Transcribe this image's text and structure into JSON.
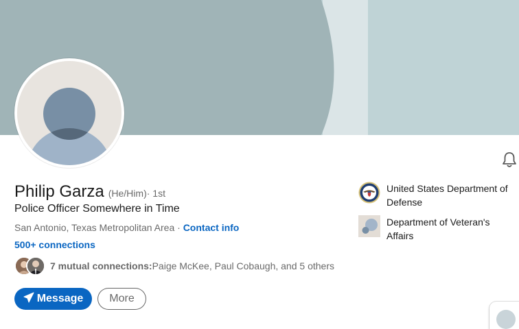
{
  "profile": {
    "name": "Philip Garza",
    "pronouns": "(He/Him)",
    "degree": " · 1st",
    "headline": "Police Officer Somewhere in Time",
    "location": "San Antonio, Texas Metropolitan Area",
    "location_sep": " · ",
    "contact_info_label": "Contact info",
    "connections_label": "500+ connections",
    "mutual": {
      "count_label": "7 mutual connections:",
      "names_label": " Paige McKee, Paul Cobaugh, and 5 others"
    }
  },
  "actions": {
    "message_label": "Message",
    "more_label": "More"
  },
  "organizations": [
    {
      "name": "United States Department of Defense",
      "logo_icon": "dod-seal-icon"
    },
    {
      "name": "Department of Veteran's Affairs",
      "logo_icon": "default-company-logo-icon"
    }
  ],
  "icons": {
    "bell": "bell-icon",
    "send": "paper-plane-icon"
  },
  "colors": {
    "accent": "#0a66c2",
    "banner_dark": "#a0b4b7",
    "banner_mid": "#dbe5e7",
    "banner_light": "#bfd3d6"
  }
}
